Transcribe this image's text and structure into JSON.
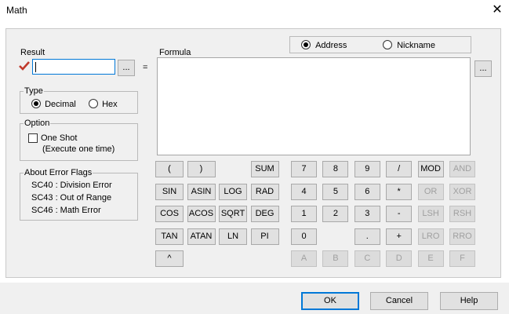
{
  "window": {
    "title": "Math",
    "close": "✕"
  },
  "mode": {
    "address_label": "Address",
    "nickname_label": "Nickname",
    "selected": "address"
  },
  "result": {
    "label": "Result",
    "value": "",
    "browse": "...",
    "equals": "="
  },
  "formula": {
    "label": "Formula",
    "value": "",
    "browse": "..."
  },
  "type": {
    "label": "Type",
    "decimal": "Decimal",
    "hex": "Hex",
    "selected": "decimal"
  },
  "option": {
    "label": "Option",
    "one_shot": "One Shot",
    "one_shot_note": "(Execute one time)",
    "one_shot_checked": false
  },
  "errors": {
    "label": "About Error Flags",
    "lines": [
      "SC40 : Division Error",
      "SC43 : Out of Range",
      "SC46 : Math Error"
    ]
  },
  "keys": {
    "func": [
      [
        "(",
        ")",
        "",
        "SUM"
      ],
      [
        "SIN",
        "ASIN",
        "LOG",
        "RAD"
      ],
      [
        "COS",
        "ACOS",
        "SQRT",
        "DEG"
      ],
      [
        "TAN",
        "ATAN",
        "LN",
        "PI"
      ],
      [
        "^",
        "",
        "",
        ""
      ]
    ],
    "num": [
      [
        "7",
        "8",
        "9",
        "/",
        "MOD",
        "AND"
      ],
      [
        "4",
        "5",
        "6",
        "*",
        "OR",
        "XOR"
      ],
      [
        "1",
        "2",
        "3",
        "-",
        "LSH",
        "RSH"
      ],
      [
        "0",
        "",
        ".",
        "+",
        "LRO",
        "RRO"
      ],
      [
        "A",
        "B",
        "C",
        "D",
        "E",
        "F"
      ]
    ],
    "disabled": [
      "AND",
      "OR",
      "XOR",
      "LSH",
      "RSH",
      "LRO",
      "RRO",
      "A",
      "B",
      "C",
      "D",
      "E",
      "F"
    ]
  },
  "buttons": {
    "ok": "OK",
    "cancel": "Cancel",
    "help": "Help"
  },
  "colors": {
    "check_mark": "#c0392b",
    "focus_border": "#0078d7"
  }
}
